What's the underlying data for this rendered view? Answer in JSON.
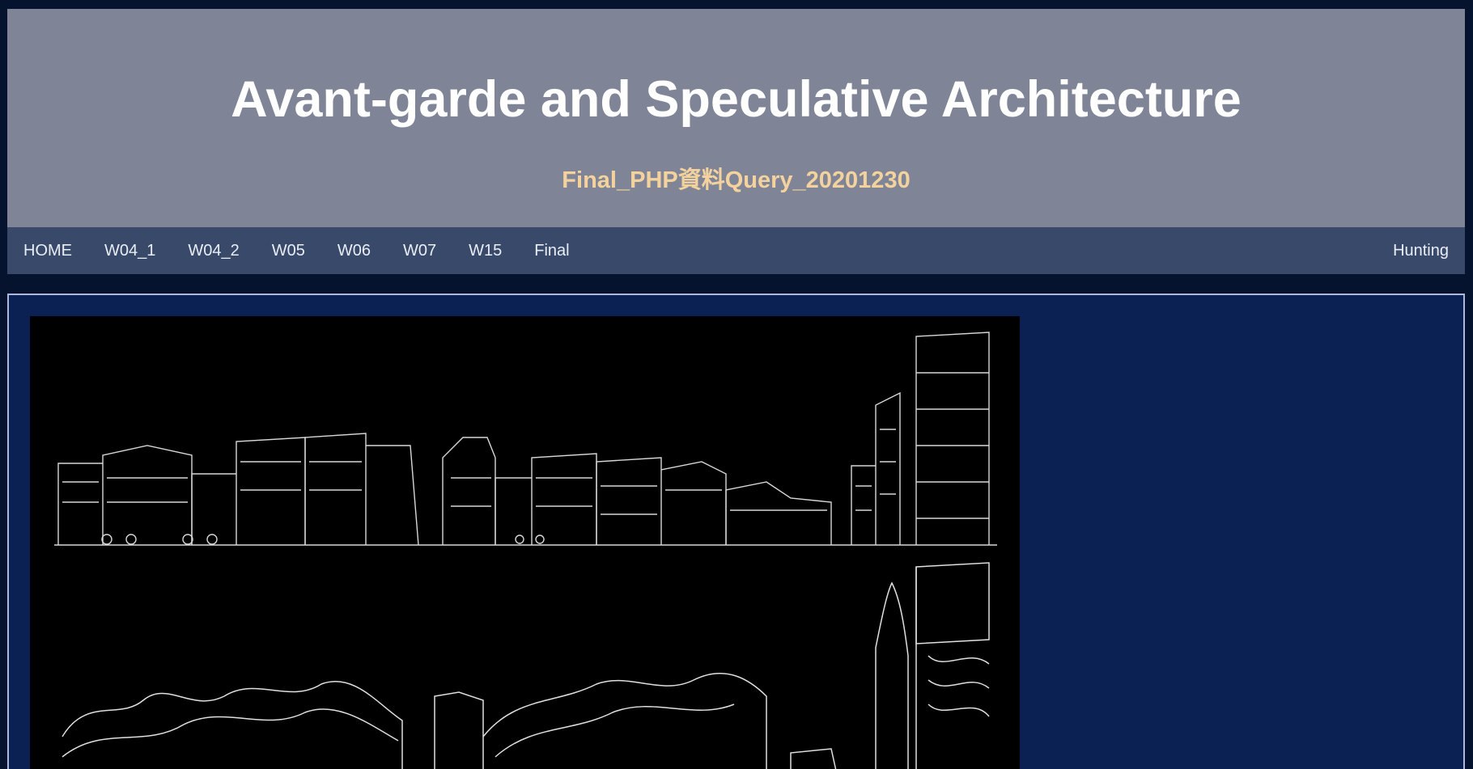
{
  "header": {
    "title": "Avant-garde and Speculative Architecture",
    "subtitle": "Final_PHP資料Query_20201230"
  },
  "nav": {
    "items": [
      {
        "label": "HOME"
      },
      {
        "label": "W04_1"
      },
      {
        "label": "W04_2"
      },
      {
        "label": "W05"
      },
      {
        "label": "W06"
      },
      {
        "label": "W07"
      },
      {
        "label": "W15"
      },
      {
        "label": "Final"
      }
    ],
    "right_label": "Hunting"
  },
  "colors": {
    "page_background": "#06132f",
    "header_background": "#7f8596",
    "title_color": "#ffffff",
    "subtitle_color": "#f4d29e",
    "nav_background": "#39496a",
    "content_background": "#0b2154",
    "content_border": "#aeb8de"
  },
  "artwork": {
    "description_icon": "streetscape-sketch-image"
  }
}
